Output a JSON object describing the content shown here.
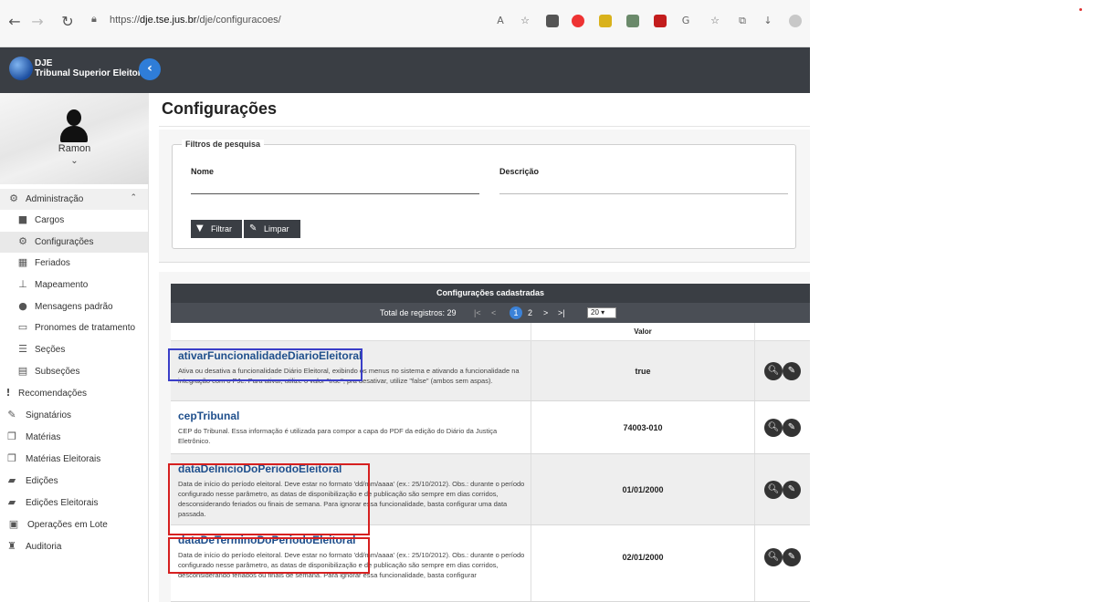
{
  "browser": {
    "url_prefix": "https://",
    "url_host": "dje.tse.jus.br",
    "url_path": "/dje/configuracoes/"
  },
  "header": {
    "logo_line1": "DJE",
    "logo_line2": "Tribunal Superior Eleitoral"
  },
  "sidebar": {
    "user_name": "Ramon",
    "items": [
      {
        "label": "Administração",
        "icon": "cogs-icon"
      },
      {
        "label": "Cargos",
        "icon": "briefcase-icon"
      },
      {
        "label": "Configurações",
        "icon": "gear-icon"
      },
      {
        "label": "Feriados",
        "icon": "calendar-icon"
      },
      {
        "label": "Mapeamento",
        "icon": "sitemap-icon"
      },
      {
        "label": "Mensagens padrão",
        "icon": "comment-icon"
      },
      {
        "label": "Pronomes de tratamento",
        "icon": "id-card-icon"
      },
      {
        "label": "Seções",
        "icon": "list-icon"
      },
      {
        "label": "Subseções",
        "icon": "window-icon"
      },
      {
        "label": "Recomendações",
        "icon": "exclamation-icon"
      },
      {
        "label": "Signatários",
        "icon": "edit-icon"
      },
      {
        "label": "Matérias",
        "icon": "copy-icon"
      },
      {
        "label": "Matérias Eleitorais",
        "icon": "copy-icon"
      },
      {
        "label": "Edições",
        "icon": "book-icon"
      },
      {
        "label": "Edições Eleitorais",
        "icon": "book-icon"
      },
      {
        "label": "Operações em Lote",
        "icon": "batch-icon"
      },
      {
        "label": "Auditoria",
        "icon": "user-secret-icon"
      }
    ]
  },
  "main": {
    "title": "Configurações",
    "filters": {
      "legend": "Filtros de pesquisa",
      "name_label": "Nome",
      "desc_label": "Descrição",
      "filter_button": "Filtrar",
      "clear_button": "Limpar"
    },
    "table": {
      "caption": "Configurações cadastradas",
      "total_label": "Total de registros: 29",
      "page_current": "1",
      "page_next": "2",
      "page_size": "20",
      "col_value": "Valor",
      "rows": [
        {
          "name": "ativarFuncionalidadeDiarioEleitoral",
          "desc": "Ativa ou desativa a funcionalidade Diário Eleitoral, exibindo os menus no sistema e ativando a funcionalidade na integração com o PJe. Para ativar, utilize o valor \"true\"; pra desativar, utilize \"false\" (ambos sem aspas).",
          "value": "true"
        },
        {
          "name": "cepTribunal",
          "desc": "CEP do Tribunal. Essa informação é utilizada para compor a capa do PDF da edição do Diário da Justiça Eletrônico.",
          "value": "74003-010"
        },
        {
          "name": "dataDeInicioDoPeriodoEleitoral",
          "desc": "Data de início do período eleitoral. Deve estar no formato 'dd/mm/aaaa' (ex.: 25/10/2012). Obs.: durante o período configurado nesse parâmetro, as datas de disponibilização e de publicação são sempre em dias corridos, desconsiderando feriados ou finais de semana. Para ignorar essa funcionalidade, basta configurar uma data passada.",
          "value": "01/01/2000"
        },
        {
          "name": "dataDeTerminoDoPeriodoEleitoral",
          "desc": "Data de início do período eleitoral. Deve estar no formato 'dd/mm/aaaa' (ex.: 25/10/2012). Obs.: durante o período configurado nesse parâmetro, as datas de disponibilização e de publicação são sempre em dias corridos, desconsiderando feriados ou finais de semana. Para ignorar essa funcionalidade, basta configurar",
          "value": "02/01/2000"
        }
      ]
    }
  },
  "colors": {
    "header_bg": "#3a3e44",
    "link": "#1f4f8c",
    "highlight_blue": "#3a3ec8",
    "highlight_red": "#d62020",
    "accent": "#2f7dd8"
  }
}
